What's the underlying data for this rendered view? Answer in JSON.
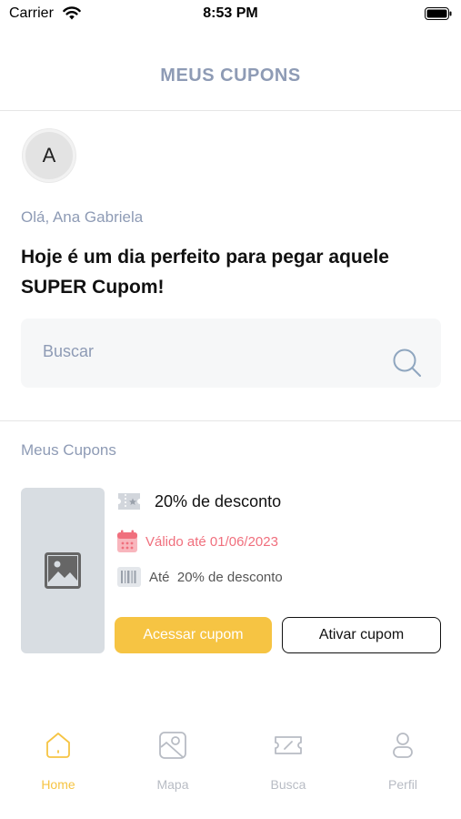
{
  "status_bar": {
    "carrier": "Carrier",
    "time": "8:53 PM"
  },
  "header": {
    "title": "MEUS CUPONS"
  },
  "user": {
    "avatar_initial": "A",
    "greeting": "Olá, Ana Gabriela"
  },
  "headline": "Hoje é um dia perfeito para pegar aquele SUPER Cupom!",
  "search": {
    "placeholder": "Buscar",
    "value": ""
  },
  "coupons_section": {
    "title": "Meus Cupons",
    "coupons": [
      {
        "title": "20% de desconto",
        "valid_until": "Válido até 01/06/2023",
        "limit": "Até  20% de desconto",
        "primary_action": "Acessar cupom",
        "secondary_action": "Ativar cupom"
      }
    ]
  },
  "tab_bar": {
    "active": "Home",
    "tabs": [
      {
        "label": "Home",
        "icon": "home-icon"
      },
      {
        "label": "Mapa",
        "icon": "map-icon"
      },
      {
        "label": "Busca",
        "icon": "ticket-icon"
      },
      {
        "label": "Perfil",
        "icon": "user-icon"
      }
    ]
  },
  "colors": {
    "accent": "#f6c443",
    "muted": "#8e9bb5",
    "danger": "#f06f7d",
    "placeholder_bg": "#d8dde2"
  }
}
